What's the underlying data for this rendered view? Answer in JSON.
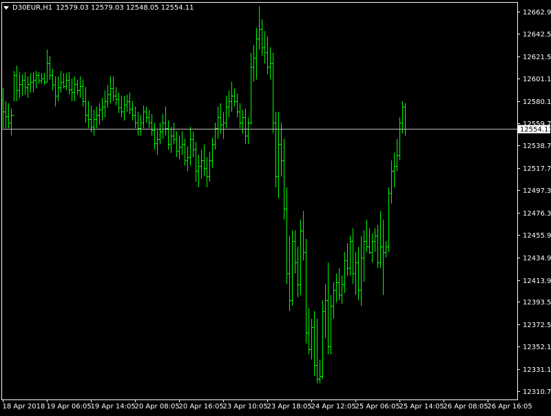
{
  "header": {
    "symbol_timeframe": "D30EUR,H1",
    "ohlc": "12579.03 12579.03 12548.05 12554.11"
  },
  "colors": {
    "background": "#000000",
    "bar": "#00ff00",
    "axis": "#ffffff",
    "price_line": "#c0c0c0",
    "price_tag_bg": "#ffffff",
    "price_tag_text": "#000000"
  },
  "chart_data": {
    "type": "ohlc",
    "symbol": "D30EUR",
    "timeframe": "H1",
    "current_price": 12554.11,
    "current_price_label": "12554.11",
    "ylim": [
      12303,
      12672
    ],
    "y_ticks": [
      12662.9,
      12642.5,
      12621.5,
      12601.1,
      12580.1,
      12559.7,
      12538.7,
      12517.7,
      12497.3,
      12476.3,
      12455.9,
      12434.9,
      12413.9,
      12393.5,
      12372.5,
      12352.1,
      12331.1,
      12310.7
    ],
    "y_tick_labels": [
      "12662.90",
      "12642.50",
      "12621.50",
      "12601.10",
      "12580.10",
      "12559.70",
      "12538.70",
      "12517.70",
      "12497.30",
      "12476.30",
      "12455.90",
      "12434.90",
      "12413.90",
      "12393.50",
      "12372.50",
      "12352.10",
      "12331.10",
      "12310.70"
    ],
    "x_labels": [
      {
        "bar": 0,
        "label": "18 Apr 2018"
      },
      {
        "bar": 16,
        "label": "19 Apr 06:05"
      },
      {
        "bar": 32,
        "label": "19 Apr 14:05"
      },
      {
        "bar": 48,
        "label": "20 Apr 08:05"
      },
      {
        "bar": 64,
        "label": "20 Apr 16:05"
      },
      {
        "bar": 80,
        "label": "23 Apr 10:05"
      },
      {
        "bar": 96,
        "label": "23 Apr 18:05"
      },
      {
        "bar": 112,
        "label": "24 Apr 12:05"
      },
      {
        "bar": 128,
        "label": "25 Apr 06:05"
      },
      {
        "bar": 144,
        "label": "25 Apr 14:05"
      },
      {
        "bar": 160,
        "label": "26 Apr 08:05"
      },
      {
        "bar": 176,
        "label": "26 Apr 16:05"
      }
    ],
    "bars": [
      {
        "o": 12581,
        "h": 12592,
        "l": 12555,
        "c": 12570
      },
      {
        "o": 12570,
        "h": 12580,
        "l": 12555,
        "c": 12566
      },
      {
        "o": 12566,
        "h": 12578,
        "l": 12555,
        "c": 12560
      },
      {
        "o": 12560,
        "h": 12573,
        "l": 12548,
        "c": 12567
      },
      {
        "o": 12567,
        "h": 12608,
        "l": 12580,
        "c": 12604
      },
      {
        "o": 12604,
        "h": 12613,
        "l": 12580,
        "c": 12590
      },
      {
        "o": 12590,
        "h": 12607,
        "l": 12583,
        "c": 12596
      },
      {
        "o": 12596,
        "h": 12605,
        "l": 12585,
        "c": 12600
      },
      {
        "o": 12600,
        "h": 12607,
        "l": 12586,
        "c": 12593
      },
      {
        "o": 12593,
        "h": 12603,
        "l": 12583,
        "c": 12596
      },
      {
        "o": 12596,
        "h": 12606,
        "l": 12588,
        "c": 12598
      },
      {
        "o": 12598,
        "h": 12607,
        "l": 12588,
        "c": 12600
      },
      {
        "o": 12600,
        "h": 12608,
        "l": 12592,
        "c": 12604
      },
      {
        "o": 12604,
        "h": 12607,
        "l": 12596,
        "c": 12599
      },
      {
        "o": 12599,
        "h": 12606,
        "l": 12596,
        "c": 12601
      },
      {
        "o": 12601,
        "h": 12606,
        "l": 12595,
        "c": 12598
      },
      {
        "o": 12598,
        "h": 12628,
        "l": 12597,
        "c": 12615
      },
      {
        "o": 12615,
        "h": 12622,
        "l": 12600,
        "c": 12604
      },
      {
        "o": 12604,
        "h": 12610,
        "l": 12590,
        "c": 12595
      },
      {
        "o": 12595,
        "h": 12603,
        "l": 12575,
        "c": 12585
      },
      {
        "o": 12585,
        "h": 12603,
        "l": 12580,
        "c": 12593
      },
      {
        "o": 12593,
        "h": 12608,
        "l": 12588,
        "c": 12598
      },
      {
        "o": 12598,
        "h": 12606,
        "l": 12592,
        "c": 12594
      },
      {
        "o": 12594,
        "h": 12606,
        "l": 12590,
        "c": 12600
      },
      {
        "o": 12600,
        "h": 12607,
        "l": 12586,
        "c": 12591
      },
      {
        "o": 12591,
        "h": 12601,
        "l": 12580,
        "c": 12588
      },
      {
        "o": 12588,
        "h": 12603,
        "l": 12580,
        "c": 12596
      },
      {
        "o": 12596,
        "h": 12600,
        "l": 12586,
        "c": 12590
      },
      {
        "o": 12590,
        "h": 12603,
        "l": 12583,
        "c": 12594
      },
      {
        "o": 12594,
        "h": 12600,
        "l": 12575,
        "c": 12580
      },
      {
        "o": 12580,
        "h": 12593,
        "l": 12560,
        "c": 12567
      },
      {
        "o": 12567,
        "h": 12580,
        "l": 12555,
        "c": 12563
      },
      {
        "o": 12563,
        "h": 12576,
        "l": 12551,
        "c": 12556
      },
      {
        "o": 12556,
        "h": 12572,
        "l": 12548,
        "c": 12563
      },
      {
        "o": 12563,
        "h": 12575,
        "l": 12555,
        "c": 12567
      },
      {
        "o": 12567,
        "h": 12578,
        "l": 12558,
        "c": 12572
      },
      {
        "o": 12572,
        "h": 12583,
        "l": 12562,
        "c": 12575
      },
      {
        "o": 12575,
        "h": 12590,
        "l": 12565,
        "c": 12580
      },
      {
        "o": 12580,
        "h": 12595,
        "l": 12574,
        "c": 12586
      },
      {
        "o": 12586,
        "h": 12603,
        "l": 12578,
        "c": 12592
      },
      {
        "o": 12592,
        "h": 12603,
        "l": 12580,
        "c": 12585
      },
      {
        "o": 12585,
        "h": 12593,
        "l": 12576,
        "c": 12582
      },
      {
        "o": 12582,
        "h": 12588,
        "l": 12569,
        "c": 12574
      },
      {
        "o": 12574,
        "h": 12585,
        "l": 12565,
        "c": 12570
      },
      {
        "o": 12570,
        "h": 12585,
        "l": 12562,
        "c": 12577
      },
      {
        "o": 12577,
        "h": 12586,
        "l": 12570,
        "c": 12580
      },
      {
        "o": 12580,
        "h": 12588,
        "l": 12568,
        "c": 12573
      },
      {
        "o": 12573,
        "h": 12580,
        "l": 12562,
        "c": 12567
      },
      {
        "o": 12567,
        "h": 12575,
        "l": 12555,
        "c": 12560
      },
      {
        "o": 12560,
        "h": 12570,
        "l": 12548,
        "c": 12555
      },
      {
        "o": 12555,
        "h": 12567,
        "l": 12548,
        "c": 12560
      },
      {
        "o": 12560,
        "h": 12576,
        "l": 12555,
        "c": 12570
      },
      {
        "o": 12570,
        "h": 12575,
        "l": 12560,
        "c": 12565
      },
      {
        "o": 12565,
        "h": 12572,
        "l": 12555,
        "c": 12560
      },
      {
        "o": 12560,
        "h": 12568,
        "l": 12548,
        "c": 12553
      },
      {
        "o": 12553,
        "h": 12560,
        "l": 12535,
        "c": 12541
      },
      {
        "o": 12541,
        "h": 12553,
        "l": 12530,
        "c": 12545
      },
      {
        "o": 12545,
        "h": 12560,
        "l": 12540,
        "c": 12552
      },
      {
        "o": 12552,
        "h": 12568,
        "l": 12545,
        "c": 12560
      },
      {
        "o": 12560,
        "h": 12575,
        "l": 12548,
        "c": 12555
      },
      {
        "o": 12555,
        "h": 12562,
        "l": 12535,
        "c": 12540
      },
      {
        "o": 12540,
        "h": 12556,
        "l": 12532,
        "c": 12548
      },
      {
        "o": 12548,
        "h": 12560,
        "l": 12540,
        "c": 12545
      },
      {
        "o": 12545,
        "h": 12552,
        "l": 12528,
        "c": 12534
      },
      {
        "o": 12534,
        "h": 12548,
        "l": 12526,
        "c": 12538
      },
      {
        "o": 12538,
        "h": 12552,
        "l": 12530,
        "c": 12540
      },
      {
        "o": 12540,
        "h": 12545,
        "l": 12520,
        "c": 12525
      },
      {
        "o": 12525,
        "h": 12538,
        "l": 12515,
        "c": 12528
      },
      {
        "o": 12528,
        "h": 12556,
        "l": 12520,
        "c": 12545
      },
      {
        "o": 12545,
        "h": 12552,
        "l": 12528,
        "c": 12535
      },
      {
        "o": 12535,
        "h": 12542,
        "l": 12505,
        "c": 12515
      },
      {
        "o": 12515,
        "h": 12530,
        "l": 12500,
        "c": 12520
      },
      {
        "o": 12520,
        "h": 12535,
        "l": 12508,
        "c": 12525
      },
      {
        "o": 12525,
        "h": 12540,
        "l": 12510,
        "c": 12518
      },
      {
        "o": 12518,
        "h": 12528,
        "l": 12500,
        "c": 12510
      },
      {
        "o": 12510,
        "h": 12533,
        "l": 12505,
        "c": 12525
      },
      {
        "o": 12525,
        "h": 12546,
        "l": 12518,
        "c": 12540
      },
      {
        "o": 12540,
        "h": 12560,
        "l": 12535,
        "c": 12555
      },
      {
        "o": 12555,
        "h": 12575,
        "l": 12545,
        "c": 12565
      },
      {
        "o": 12565,
        "h": 12578,
        "l": 12550,
        "c": 12558
      },
      {
        "o": 12558,
        "h": 12570,
        "l": 12545,
        "c": 12560
      },
      {
        "o": 12560,
        "h": 12585,
        "l": 12555,
        "c": 12575
      },
      {
        "o": 12575,
        "h": 12590,
        "l": 12565,
        "c": 12580
      },
      {
        "o": 12580,
        "h": 12598,
        "l": 12570,
        "c": 12585
      },
      {
        "o": 12585,
        "h": 12592,
        "l": 12575,
        "c": 12580
      },
      {
        "o": 12580,
        "h": 12587,
        "l": 12565,
        "c": 12570
      },
      {
        "o": 12570,
        "h": 12578,
        "l": 12555,
        "c": 12560
      },
      {
        "o": 12560,
        "h": 12572,
        "l": 12550,
        "c": 12565
      },
      {
        "o": 12565,
        "h": 12573,
        "l": 12540,
        "c": 12548
      },
      {
        "o": 12548,
        "h": 12565,
        "l": 12540,
        "c": 12560
      },
      {
        "o": 12560,
        "h": 12625,
        "l": 12558,
        "c": 12612
      },
      {
        "o": 12612,
        "h": 12632,
        "l": 12598,
        "c": 12620
      },
      {
        "o": 12620,
        "h": 12648,
        "l": 12600,
        "c": 12638
      },
      {
        "o": 12638,
        "h": 12668,
        "l": 12628,
        "c": 12647
      },
      {
        "o": 12647,
        "h": 12656,
        "l": 12622,
        "c": 12630
      },
      {
        "o": 12630,
        "h": 12645,
        "l": 12615,
        "c": 12625
      },
      {
        "o": 12625,
        "h": 12640,
        "l": 12605,
        "c": 12612
      },
      {
        "o": 12612,
        "h": 12630,
        "l": 12600,
        "c": 12615
      },
      {
        "o": 12615,
        "h": 12625,
        "l": 12550,
        "c": 12560
      },
      {
        "o": 12560,
        "h": 12570,
        "l": 12500,
        "c": 12510
      },
      {
        "o": 12510,
        "h": 12570,
        "l": 12490,
        "c": 12540
      },
      {
        "o": 12540,
        "h": 12560,
        "l": 12510,
        "c": 12525
      },
      {
        "o": 12525,
        "h": 12545,
        "l": 12470,
        "c": 12480
      },
      {
        "o": 12480,
        "h": 12500,
        "l": 12410,
        "c": 12420
      },
      {
        "o": 12420,
        "h": 12455,
        "l": 12385,
        "c": 12395
      },
      {
        "o": 12395,
        "h": 12460,
        "l": 12390,
        "c": 12450
      },
      {
        "o": 12450,
        "h": 12460,
        "l": 12420,
        "c": 12430
      },
      {
        "o": 12430,
        "h": 12445,
        "l": 12398,
        "c": 12410
      },
      {
        "o": 12410,
        "h": 12470,
        "l": 12400,
        "c": 12460
      },
      {
        "o": 12460,
        "h": 12478,
        "l": 12432,
        "c": 12440
      },
      {
        "o": 12440,
        "h": 12452,
        "l": 12355,
        "c": 12365
      },
      {
        "o": 12365,
        "h": 12388,
        "l": 12345,
        "c": 12350
      },
      {
        "o": 12350,
        "h": 12378,
        "l": 12340,
        "c": 12370
      },
      {
        "o": 12370,
        "h": 12385,
        "l": 12325,
        "c": 12335
      },
      {
        "o": 12335,
        "h": 12378,
        "l": 12318,
        "c": 12322
      },
      {
        "o": 12322,
        "h": 12340,
        "l": 12318,
        "c": 12325
      },
      {
        "o": 12325,
        "h": 12395,
        "l": 12322,
        "c": 12385
      },
      {
        "o": 12385,
        "h": 12410,
        "l": 12360,
        "c": 12395
      },
      {
        "o": 12395,
        "h": 12430,
        "l": 12345,
        "c": 12352
      },
      {
        "o": 12352,
        "h": 12400,
        "l": 12345,
        "c": 12390
      },
      {
        "o": 12390,
        "h": 12412,
        "l": 12378,
        "c": 12405
      },
      {
        "o": 12405,
        "h": 12420,
        "l": 12393,
        "c": 12412
      },
      {
        "o": 12412,
        "h": 12425,
        "l": 12395,
        "c": 12400
      },
      {
        "o": 12400,
        "h": 12418,
        "l": 12392,
        "c": 12410
      },
      {
        "o": 12410,
        "h": 12440,
        "l": 12402,
        "c": 12432
      },
      {
        "o": 12432,
        "h": 12448,
        "l": 12418,
        "c": 12425
      },
      {
        "o": 12425,
        "h": 12455,
        "l": 12418,
        "c": 12450
      },
      {
        "o": 12450,
        "h": 12462,
        "l": 12410,
        "c": 12420
      },
      {
        "o": 12420,
        "h": 12440,
        "l": 12400,
        "c": 12430
      },
      {
        "o": 12430,
        "h": 12445,
        "l": 12395,
        "c": 12405
      },
      {
        "o": 12405,
        "h": 12455,
        "l": 12390,
        "c": 12435
      },
      {
        "o": 12435,
        "h": 12460,
        "l": 12412,
        "c": 12450
      },
      {
        "o": 12450,
        "h": 12470,
        "l": 12440,
        "c": 12445
      },
      {
        "o": 12445,
        "h": 12462,
        "l": 12438,
        "c": 12440
      },
      {
        "o": 12440,
        "h": 12457,
        "l": 12430,
        "c": 12450
      },
      {
        "o": 12450,
        "h": 12462,
        "l": 12440,
        "c": 12455
      },
      {
        "o": 12455,
        "h": 12465,
        "l": 12425,
        "c": 12430
      },
      {
        "o": 12430,
        "h": 12478,
        "l": 12425,
        "c": 12445
      },
      {
        "o": 12445,
        "h": 12470,
        "l": 12400,
        "c": 12440
      },
      {
        "o": 12440,
        "h": 12450,
        "l": 12435,
        "c": 12445
      },
      {
        "o": 12445,
        "h": 12500,
        "l": 12440,
        "c": 12495
      },
      {
        "o": 12495,
        "h": 12525,
        "l": 12485,
        "c": 12515
      },
      {
        "o": 12515,
        "h": 12532,
        "l": 12500,
        "c": 12520
      },
      {
        "o": 12520,
        "h": 12545,
        "l": 12515,
        "c": 12530
      },
      {
        "o": 12530,
        "h": 12565,
        "l": 12525,
        "c": 12560
      },
      {
        "o": 12560,
        "h": 12580,
        "l": 12550,
        "c": 12575
      },
      {
        "o": 12575,
        "h": 12578,
        "l": 12548,
        "c": 12554.11
      }
    ]
  }
}
